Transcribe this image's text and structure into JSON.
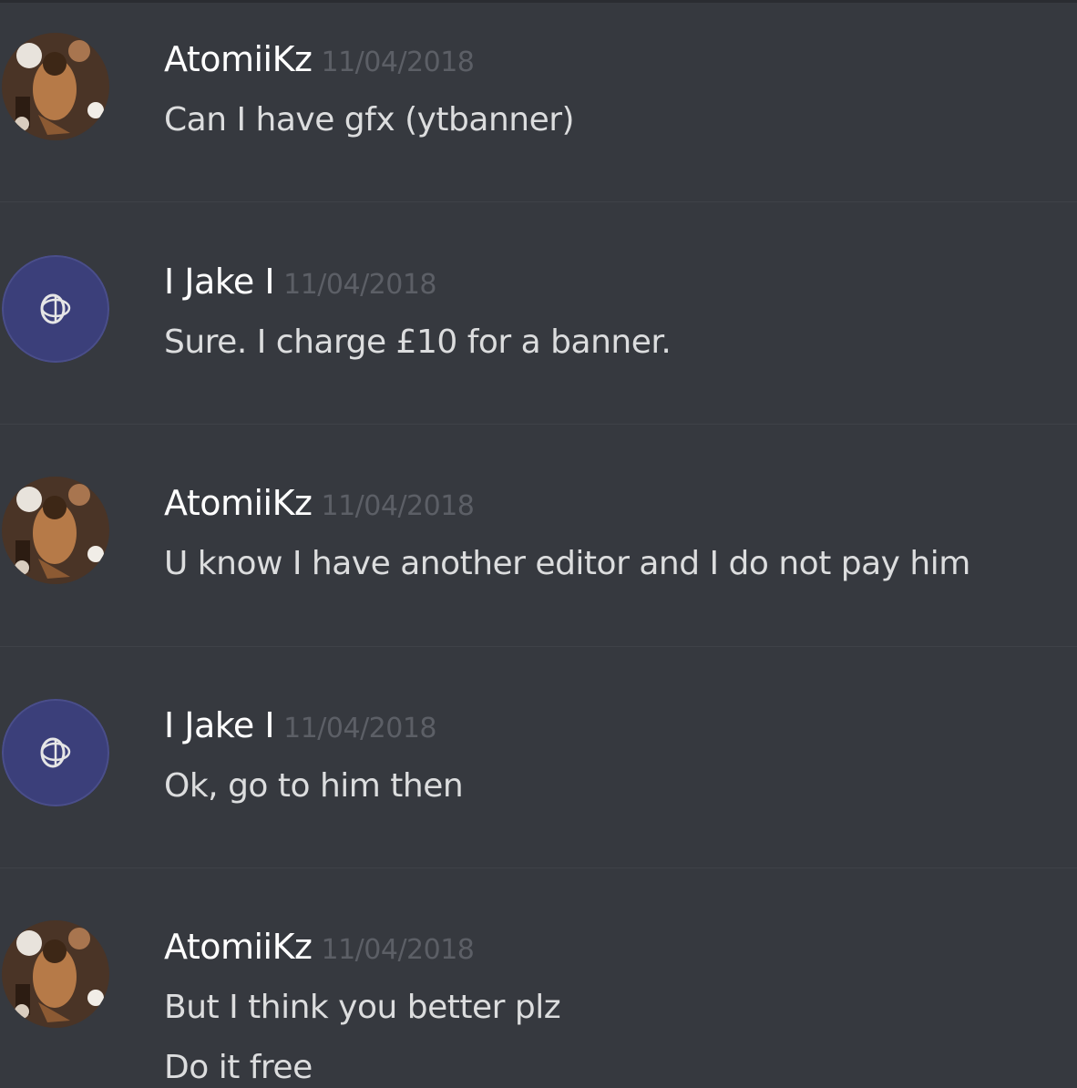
{
  "messages": [
    {
      "username": "AtomiiKz",
      "timestamp": "11/04/2018",
      "lines": [
        "Can I have gfx (ytbanner)"
      ],
      "avatar": "atomiikz-avatar"
    },
    {
      "username": "I Jake I",
      "timestamp": "11/04/2018",
      "lines": [
        "Sure. I charge £10 for a banner."
      ],
      "avatar": "jake-avatar"
    },
    {
      "username": "AtomiiKz",
      "timestamp": "11/04/2018",
      "lines": [
        "U know I have another editor and I do not pay him"
      ],
      "avatar": "atomiikz-avatar"
    },
    {
      "username": "I Jake I",
      "timestamp": "11/04/2018",
      "lines": [
        "Ok, go to him then"
      ],
      "avatar": "jake-avatar"
    },
    {
      "username": "AtomiiKz",
      "timestamp": "11/04/2018",
      "lines": [
        "But I think you better plz",
        "Do it free"
      ],
      "avatar": "atomiikz-avatar"
    }
  ],
  "colors": {
    "background": "#36393f",
    "username": "#ffffff",
    "timestamp": "#5c5f66",
    "message_text": "#dcddde",
    "jake_avatar_bg": "#3b3f7a"
  }
}
